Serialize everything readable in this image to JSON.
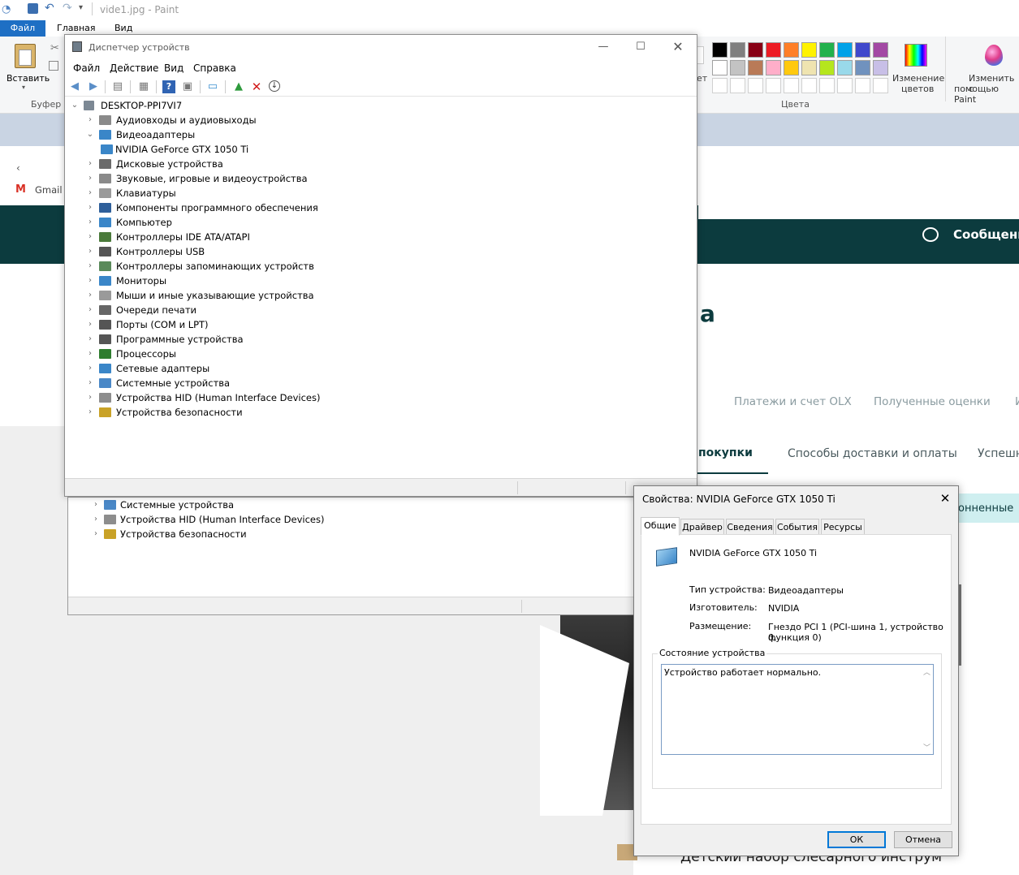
{
  "paint": {
    "title": "vide1.jpg - Paint",
    "tabs": {
      "file": "Файл",
      "home": "Главная",
      "view": "Вид"
    },
    "ribbon": {
      "paste": "Вставить",
      "clipboard": "Буфер о",
      "colors_group": "Цвета",
      "edit_colors_line1": "Изменение",
      "edit_colors_line2": "цветов",
      "paint3d_line1": "Изменить с",
      "paint3d_line2": "помощью Paint",
      "partial_label": "ет"
    },
    "palette_row1": [
      "#000000",
      "#7f7f7f",
      "#880015",
      "#ed1c24",
      "#ff7f27",
      "#fff200",
      "#22b14c",
      "#00a2e8",
      "#3f48cc",
      "#a349a4"
    ],
    "palette_row2": [
      "#ffffff",
      "#c3c3c3",
      "#b97a57",
      "#ffaec9",
      "#ffc90e",
      "#efe4b0",
      "#b5e61d",
      "#99d9ea",
      "#7092be",
      "#c8bfe7"
    ]
  },
  "website": {
    "gmail": "Gmail",
    "messages": "Сообщени",
    "heading_fragment": "а",
    "nav_links": [
      "Платежи и счет OLX",
      "Полученные оценки",
      "И"
    ],
    "subtabs": [
      "покупки",
      "Способы доставки и оплаты",
      "Успешн"
    ],
    "pill": "онненные",
    "bottom_text": "Детский набор слесарного инструм"
  },
  "device_manager": {
    "title": "Диспетчер устройств",
    "menu": [
      "Файл",
      "Действие",
      "Вид",
      "Справка"
    ],
    "root": "DESKTOP-PPI7VI7",
    "items": [
      {
        "label": "Аудиовходы и аудиовыходы",
        "expanded": false
      },
      {
        "label": "Видеоадаптеры",
        "expanded": true
      },
      {
        "label": "NVIDIA GeForce GTX 1050 Ti",
        "child": true
      },
      {
        "label": "Дисковые устройства",
        "expanded": false
      },
      {
        "label": "Звуковые, игровые и видеоустройства",
        "expanded": false
      },
      {
        "label": "Клавиатуры",
        "expanded": false
      },
      {
        "label": "Компоненты программного обеспечения",
        "expanded": false
      },
      {
        "label": "Компьютер",
        "expanded": false
      },
      {
        "label": "Контроллеры IDE ATA/ATAPI",
        "expanded": false
      },
      {
        "label": "Контроллеры USB",
        "expanded": false
      },
      {
        "label": "Контроллеры запоминающих устройств",
        "expanded": false
      },
      {
        "label": "Мониторы",
        "expanded": false
      },
      {
        "label": "Мыши и иные указывающие устройства",
        "expanded": false
      },
      {
        "label": "Очереди печати",
        "expanded": false
      },
      {
        "label": "Порты (COM и LPT)",
        "expanded": false
      },
      {
        "label": "Программные устройства",
        "expanded": false
      },
      {
        "label": "Процессоры",
        "expanded": false
      },
      {
        "label": "Сетевые адаптеры",
        "expanded": false
      },
      {
        "label": "Системные устройства",
        "expanded": false
      },
      {
        "label": "Устройства HID (Human Interface Devices)",
        "expanded": false
      },
      {
        "label": "Устройства безопасности",
        "expanded": false
      }
    ],
    "ghost_items": [
      "Системные устройства",
      "Устройства HID (Human Interface Devices)",
      "Устройства безопасности"
    ]
  },
  "properties": {
    "title": "Свойства: NVIDIA GeForce GTX 1050 Ti",
    "tabs": [
      "Общие",
      "Драйвер",
      "Сведения",
      "События",
      "Ресурсы"
    ],
    "device_name": "NVIDIA GeForce GTX 1050 Ti",
    "type_label": "Тип устройства:",
    "type_value": "Видеоадаптеры",
    "manufacturer_label": "Изготовитель:",
    "manufacturer_value": "NVIDIA",
    "location_label": "Размещение:",
    "location_value_line1": "Гнездо PCI 1 (PCI-шина 1, устройство 0,",
    "location_value_line2": "функция 0)",
    "status_group": "Состояние устройства",
    "status_text": "Устройство работает нормально.",
    "ok": "ОК",
    "cancel": "Отмена"
  }
}
